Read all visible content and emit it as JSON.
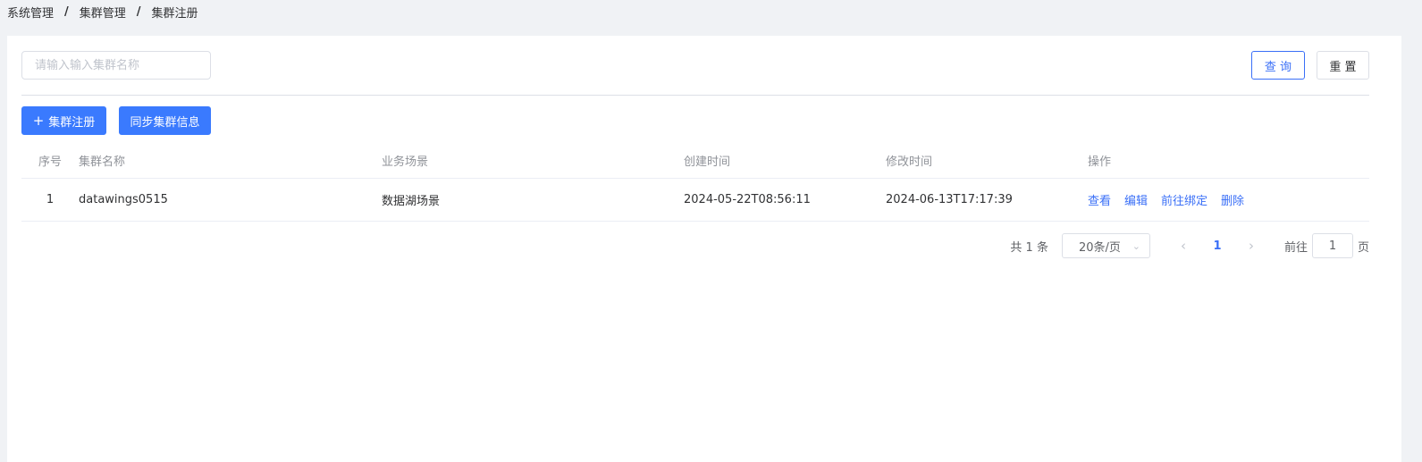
{
  "breadcrumb": {
    "items": [
      "系统管理",
      "集群管理",
      "集群注册"
    ],
    "separator": "/"
  },
  "search": {
    "placeholder": "请输入输入集群名称",
    "value": ""
  },
  "toolbar": {
    "query_label": "查 询",
    "reset_label": "重 置",
    "register_icon": "plus-icon",
    "register_label": "集群注册",
    "sync_label": "同步集群信息"
  },
  "table": {
    "columns": [
      "序号",
      "集群名称",
      "业务场景",
      "创建时间",
      "修改时间",
      "操作"
    ],
    "rows": [
      {
        "index": "1",
        "name": "datawings0515",
        "scene": "数据湖场景",
        "created": "2024-05-22T08:56:11",
        "modified": "2024-06-13T17:17:39",
        "actions": [
          "查看",
          "编辑",
          "前往绑定",
          "删除"
        ]
      }
    ]
  },
  "pagination": {
    "total": "共 1 条",
    "page_size": "20条/页",
    "current_page": "1",
    "goto_prefix": "前往",
    "goto_value": "1",
    "goto_suffix": "页"
  },
  "colors": {
    "primary": "#3a7afe",
    "link": "#3a6ff7",
    "background": "#f0f2f5"
  }
}
